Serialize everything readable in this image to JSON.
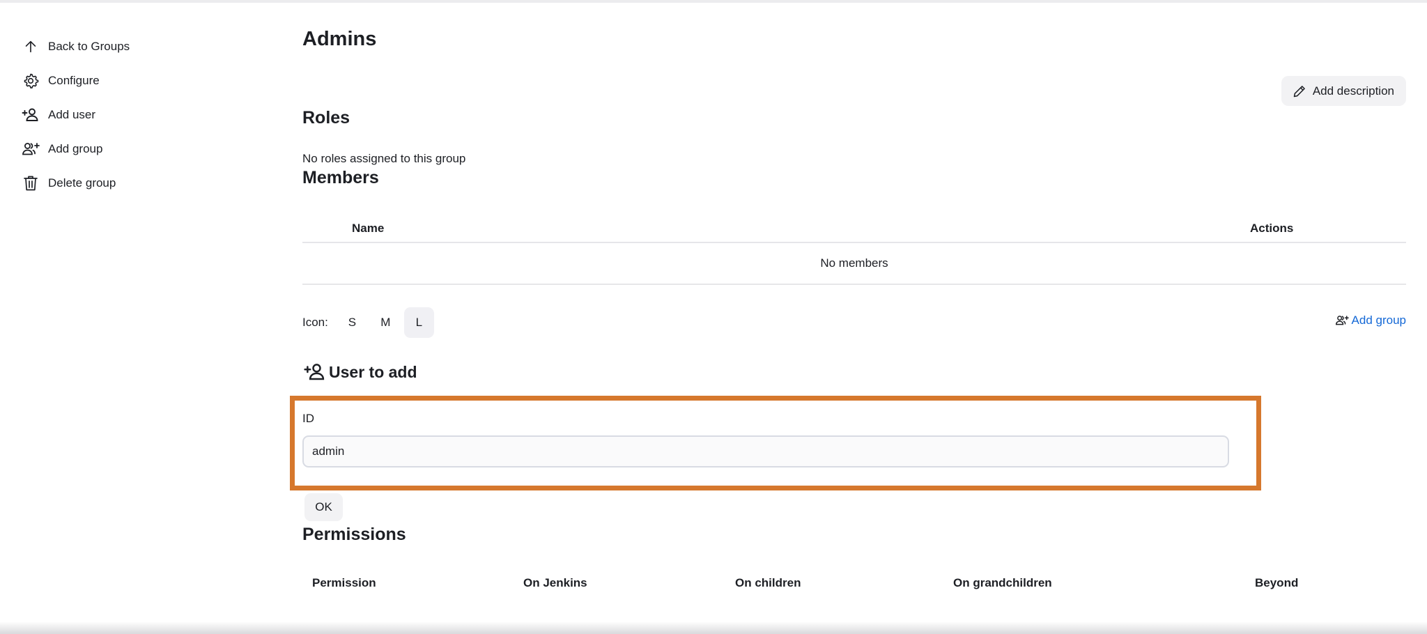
{
  "sidebar": {
    "items": [
      {
        "label": "Back to Groups",
        "icon": "arrow-up-icon"
      },
      {
        "label": "Configure",
        "icon": "gear-icon"
      },
      {
        "label": "Add user",
        "icon": "add-person-icon"
      },
      {
        "label": "Add group",
        "icon": "add-people-icon"
      },
      {
        "label": "Delete group",
        "icon": "trash-icon"
      }
    ]
  },
  "page": {
    "title": "Admins",
    "add_description_label": "Add description"
  },
  "roles": {
    "heading": "Roles",
    "empty_text": "No roles assigned to this group"
  },
  "members": {
    "heading": "Members",
    "columns": [
      "Name",
      "Actions"
    ],
    "empty_text": "No members"
  },
  "icon_size": {
    "label": "Icon:",
    "options": [
      "S",
      "M",
      "L"
    ],
    "selected": "L"
  },
  "add_group_link": "Add group",
  "user_to_add": {
    "heading": "User to add",
    "id_label": "ID",
    "id_value": "admin",
    "ok_label": "OK"
  },
  "permissions": {
    "heading": "Permissions",
    "columns": [
      "Permission",
      "On Jenkins",
      "On children",
      "On grandchildren",
      "Beyond"
    ]
  },
  "colors": {
    "highlight": "#d6782d",
    "link": "#1468d6"
  }
}
